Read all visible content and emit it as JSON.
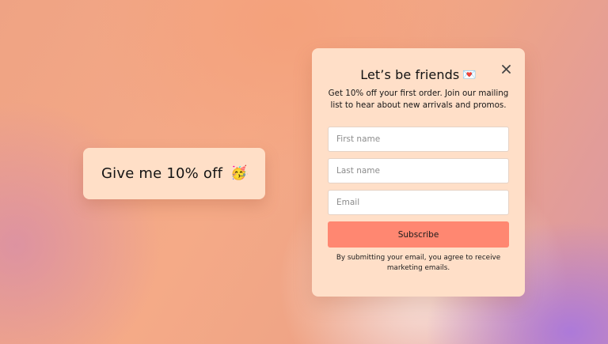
{
  "teaser": {
    "label": "Give me 10% off",
    "emoji": "🥳",
    "close_icon": "close-icon"
  },
  "popup": {
    "title": "Let’s be friends",
    "title_emoji": "💌",
    "subtitle": "Get 10% off your first order. Join our mailing list to hear about new arrivals and promos.",
    "close_icon": "close-icon",
    "fields": {
      "first_name": {
        "placeholder": "First name",
        "value": ""
      },
      "last_name": {
        "placeholder": "Last name",
        "value": ""
      },
      "email": {
        "placeholder": "Email",
        "value": ""
      }
    },
    "subscribe_label": "Subscribe",
    "disclaimer": "By submitting your email, you agree to receive marketing emails."
  },
  "colors": {
    "card_background": "#ffdfc8",
    "accent_button": "#ff8771",
    "text": "#121212"
  }
}
